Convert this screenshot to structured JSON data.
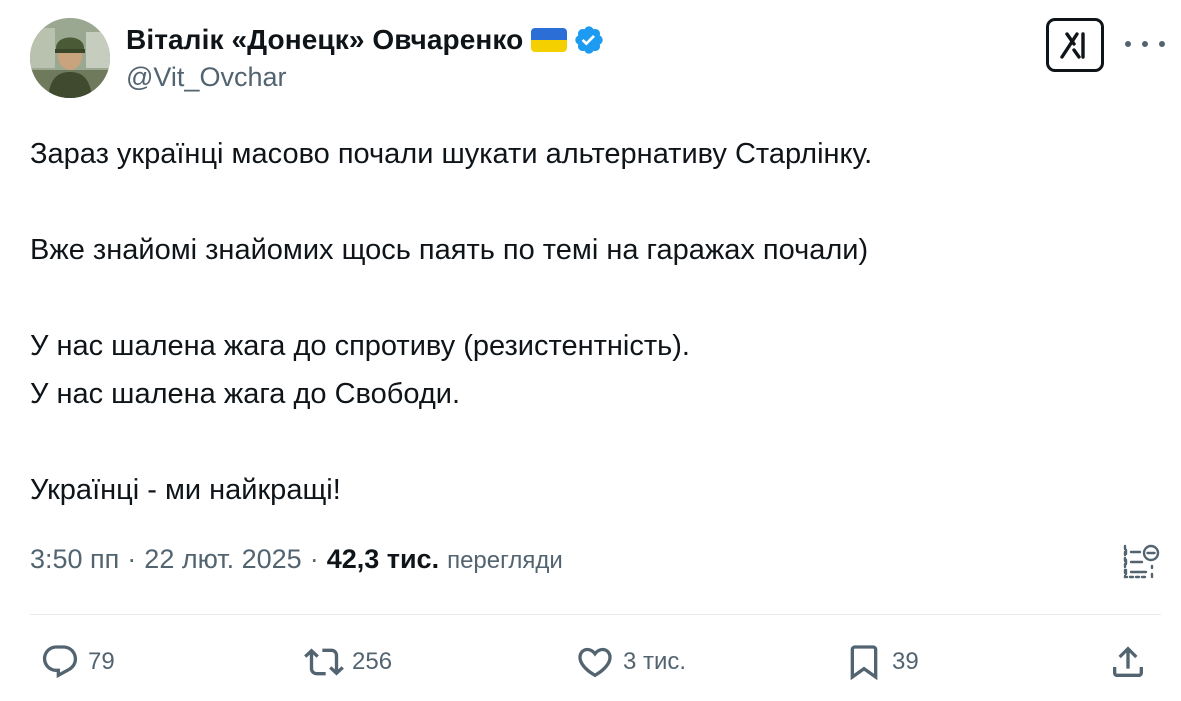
{
  "author": {
    "name": "Віталік «Донецк» Овчаренко",
    "handle": "@Vit_Ovchar"
  },
  "tweet": {
    "lines": [
      "Зараз українці масово почали шукати альтернативу Старлінку.",
      "Вже знайомі знайомих щось паять по темі на гаражах почали)",
      "У нас шалена жага до спротиву (резистентність).",
      "У нас шалена жага до Свободи.",
      "Українці - ми найкращі!"
    ]
  },
  "meta": {
    "time": "3:50 пп",
    "separator": "·",
    "date": "22 лют. 2025",
    "views_count": "42,3 тис.",
    "views_label": "перегляди"
  },
  "actions": {
    "replies": "79",
    "reposts": "256",
    "likes": "3 тис.",
    "bookmarks": "39"
  },
  "colors": {
    "text_primary": "#0f1419",
    "text_secondary": "#536471",
    "verified_blue": "#1d9bf0",
    "flag_blue": "#2b6fd6",
    "flag_yellow": "#f5d000",
    "divider": "#e6ecf0"
  }
}
